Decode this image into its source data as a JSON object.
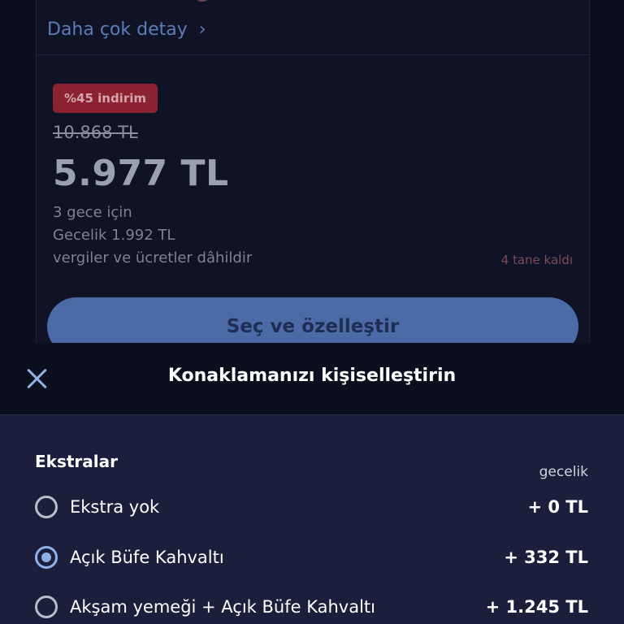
{
  "offer": {
    "more_details": "Daha çok detay",
    "discount_badge": "%45 indirim",
    "old_price": "10.868 TL",
    "price": "5.977 TL",
    "nights": "3 gece için",
    "per_night": "Gecelik 1.992 TL",
    "taxes_note": "vergiler ve ücretler dâhildir",
    "stock_left": "4 tane kaldı",
    "select_button": "Seç ve özelleştir"
  },
  "sheet": {
    "title": "Konaklamanızı kişiselleştirin",
    "section_title": "Ekstralar",
    "per_night_label": "gecelik",
    "options": [
      {
        "label": "Ekstra yok",
        "price": "+ 0 TL",
        "selected": false
      },
      {
        "label": "Açık Büfe Kahvaltı",
        "price": "+ 332 TL",
        "selected": true
      },
      {
        "label": "Akşam yemeği + Açık Büfe Kahvaltı",
        "price": "+ 1.245 TL",
        "selected": false
      }
    ]
  },
  "colors": {
    "accent": "#8fb1e8",
    "discount_bg": "#8a2232",
    "sheet_bg": "#1b1f3c"
  },
  "icons": {
    "close": "close-icon",
    "chevron": "chevron-right-icon"
  }
}
